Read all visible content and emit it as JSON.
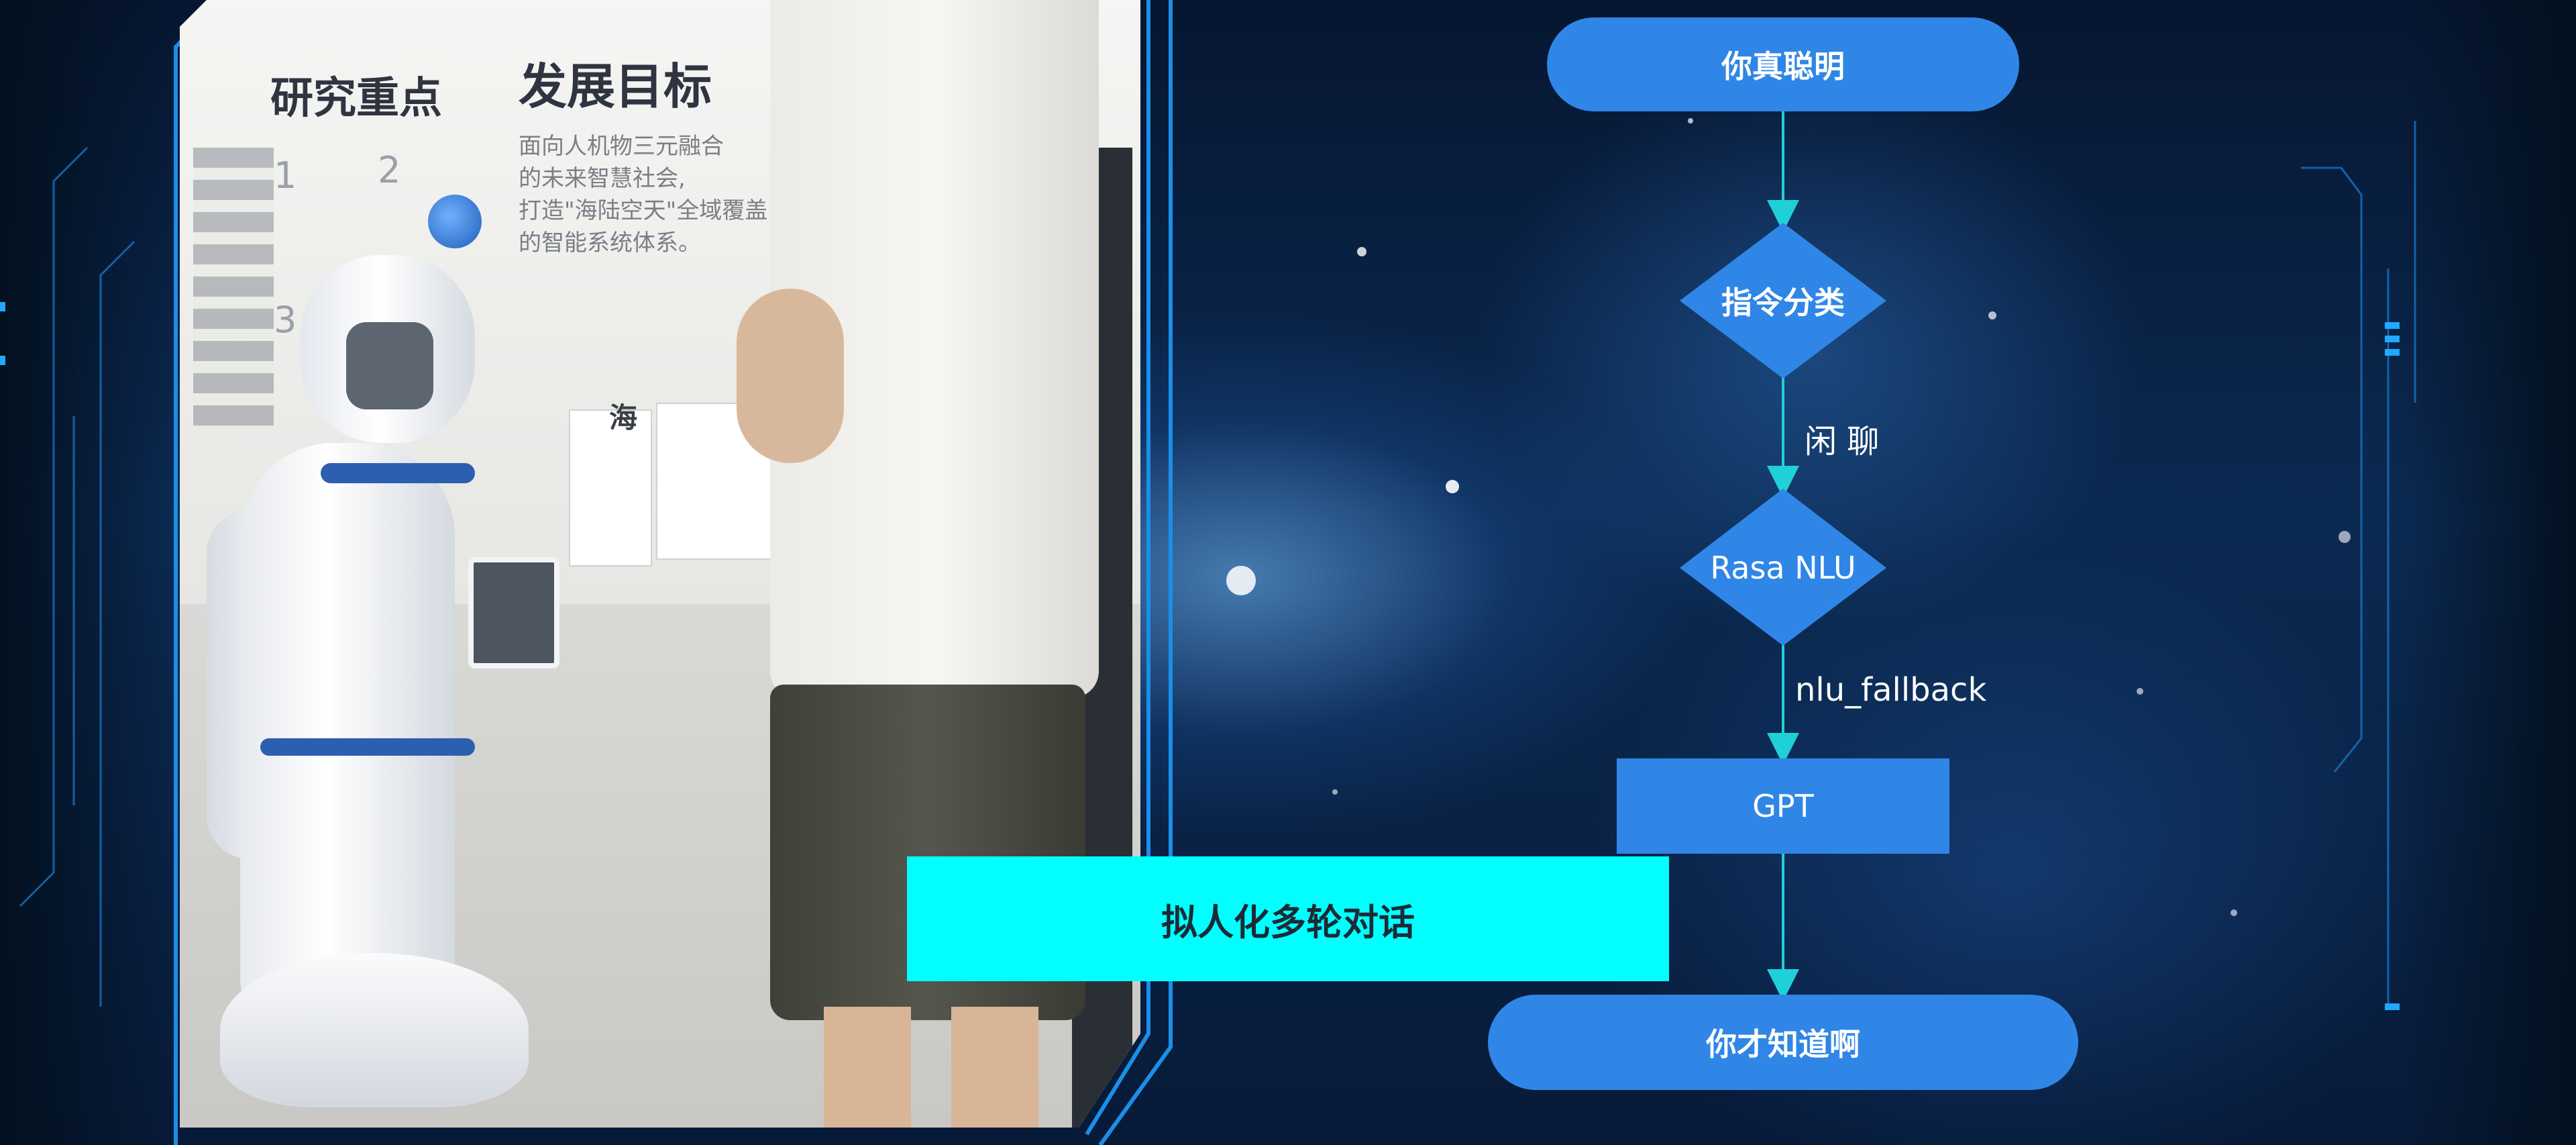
{
  "photo": {
    "wall_heading_left": "研究重点",
    "wall_heading_right": "发展目标",
    "wall_text_lines": [
      "面向人机物三元融合",
      "的未来智慧社会,",
      "打造\"海陆空天\"全域覆盖",
      "的智能系统体系。"
    ],
    "wall_numbers": [
      "1",
      "2",
      "3"
    ],
    "exhibit_char": "海"
  },
  "flowchart": {
    "start_label": "你真聪明",
    "classifier_label": "指令分类",
    "edge_chat_label": "闲 聊",
    "nlu_label": "Rasa NLU",
    "edge_fallback_label": "nlu_fallback",
    "gpt_label": "GPT",
    "end_label": "你才知道啊"
  },
  "banner": {
    "text": "拟人化多轮对话"
  },
  "colors": {
    "node_fill": "#2f86e6",
    "edge": "#1fd0d8",
    "banner": "#00ffff",
    "frame": "#1b8fe8"
  },
  "icons": [
    "robot-figure",
    "person-figure",
    "tech-frame-lines"
  ]
}
